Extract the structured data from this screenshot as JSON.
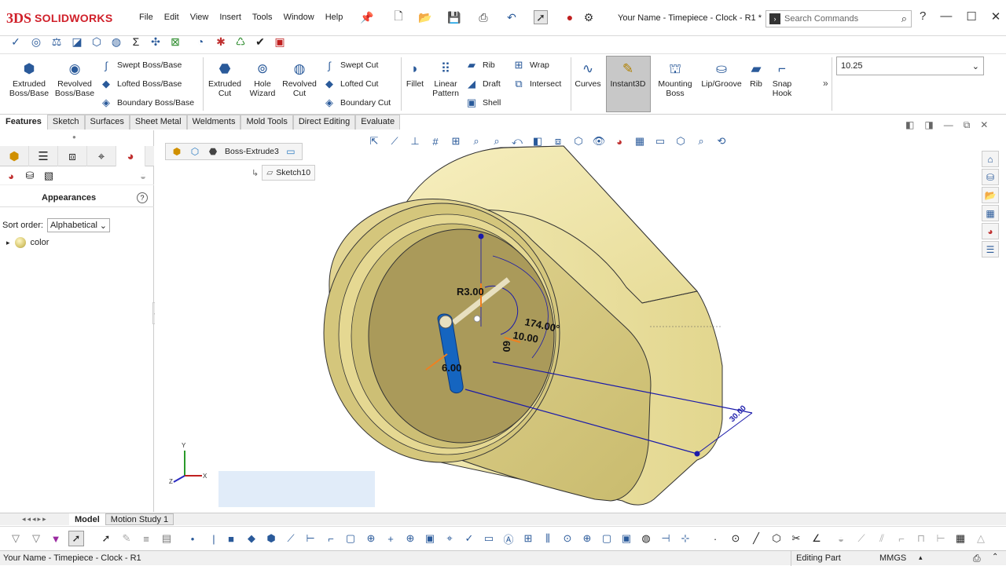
{
  "app": {
    "brand": "SOLIDWORKS",
    "brand_prefix": "3DS",
    "accent": "#d0202a"
  },
  "menu": [
    "File",
    "Edit",
    "View",
    "Insert",
    "Tools",
    "Window",
    "Help"
  ],
  "document_title": "Your Name - Timepiece - Clock - R1 *",
  "search": {
    "placeholder": "Search Commands"
  },
  "features_ribbon": {
    "extruded_boss": "Extruded Boss/Base",
    "revolved_boss": "Revolved Boss/Base",
    "swept_boss": "Swept Boss/Base",
    "lofted_boss": "Lofted Boss/Base",
    "boundary_boss": "Boundary Boss/Base",
    "extruded_cut": "Extruded Cut",
    "hole_wizard": "Hole Wizard",
    "revolved_cut": "Revolved Cut",
    "swept_cut": "Swept Cut",
    "lofted_cut": "Lofted Cut",
    "boundary_cut": "Boundary Cut",
    "fillet": "Fillet",
    "linear_pattern": "Linear Pattern",
    "rib": "Rib",
    "draft": "Draft",
    "shell": "Shell",
    "wrap": "Wrap",
    "intersect": "Intersect",
    "curves": "Curves",
    "instant3d": "Instant3D",
    "mounting_boss": "Mounting Boss",
    "lip_groove": "Lip/Groove",
    "rib2": "Rib",
    "snap_hook": "Snap Hook"
  },
  "spin_value": "10.25",
  "tabs": [
    "Features",
    "Sketch",
    "Surfaces",
    "Sheet Metal",
    "Weldments",
    "Mold Tools",
    "Direct Editing",
    "Evaluate"
  ],
  "left_panel": {
    "title": "Appearances",
    "sort_label": "Sort order:",
    "sort_value": "Alphabetical",
    "tree_item": "color"
  },
  "breadcrumb": {
    "feature": "Boss-Extrude3",
    "sketch": "Sketch10"
  },
  "dimensions": {
    "radius": "R3.00",
    "angle": "174.00°",
    "length": "10.00",
    "width": "6.00",
    "offset": "30.00",
    "short": "60"
  },
  "triad": {
    "x": "X",
    "y": "Y",
    "z": "Z"
  },
  "bottom_tabs": [
    "Model",
    "Motion Study 1"
  ],
  "status": {
    "left": "Your Name - Timepiece - Clock - R1",
    "mode": "Editing Part",
    "units": "MMGS"
  },
  "colors": {
    "body": "#efe6a8",
    "body_shade": "#c9bb6e",
    "sketch_blue": "#1a1aaa",
    "handle_blue": "#1565c0",
    "orange": "#f08020"
  }
}
